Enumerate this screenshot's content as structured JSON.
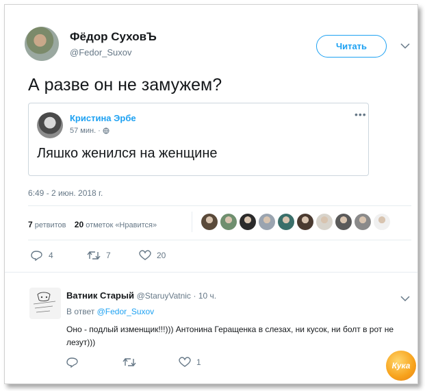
{
  "tweet": {
    "author_name": "Фёдор СуховЪ",
    "author_handle": "@Fedor_Suxov",
    "follow_label": "Читать",
    "text": "А разве он не замужем?",
    "timestamp": "6:49 - 2 июн. 2018 г.",
    "retweets_count": "7",
    "retweets_label": "ретвитов",
    "likes_count": "20",
    "likes_label": "отметок «Нравится»",
    "actions": {
      "reply_count": "4",
      "retweet_count": "7",
      "like_count": "20"
    }
  },
  "quoted": {
    "author_name": "Кристина Эрбе",
    "time": "57 мин. ·",
    "text": "Ляшко женился на женщине"
  },
  "likers": [
    "#5a4a3a",
    "#6f8f6f",
    "#2b2b2b",
    "#9aa4b0",
    "#3a6f6a",
    "#4a3a30",
    "#d8d4cc",
    "#5a5a5a",
    "#8a8a8a",
    "#f0f0f0"
  ],
  "reply": {
    "author_name": "Ватник Старый",
    "author_handle": "@StaruyVatnic",
    "time": "· 10 ч.",
    "in_reply_prefix": "В ответ",
    "in_reply_handle": "@Fedor_Suxov",
    "text": "Оно - подлый изменщик!!!))) Антонина Геращенка в слезах, ни кусок, ни болт в рот не лезут)))",
    "like_count": "1"
  },
  "watermark": "Кука",
  "colors": {
    "accent": "#1da1f2",
    "muted": "#657786",
    "text": "#14171a",
    "border": "#e6ecf0"
  }
}
